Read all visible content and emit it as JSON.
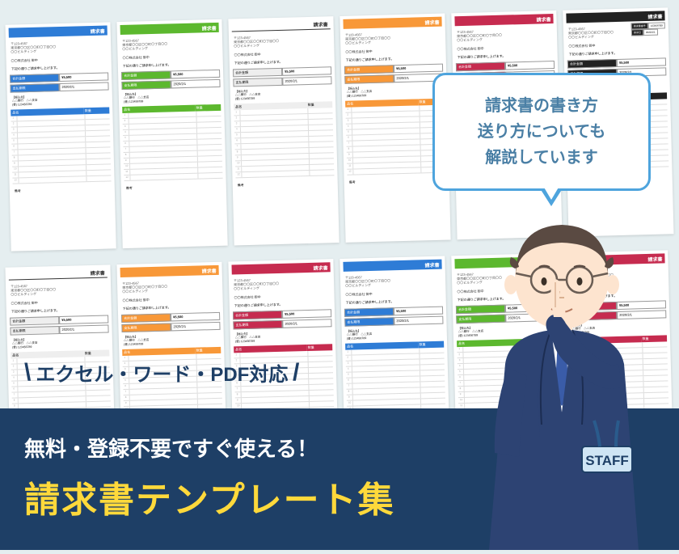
{
  "templates": {
    "title": "請求書",
    "postal": "〒123-4567",
    "address": "東京都〇〇区〇〇町〇丁目〇〇",
    "building": "〇〇ビルディング",
    "company": "〇〇株式会社 御中",
    "ack": "下記の通りご請求申し上げます。",
    "sum_label": "合計金額",
    "sum_value": "¥5,500",
    "due_label": "支払期限",
    "due_value": "2020/2/1",
    "bank_title": "【振込先】",
    "bank_branch": "△△銀行　△△支店",
    "bank_number": "(普) 123456789",
    "col_item": "品名",
    "col_qty": "数量",
    "rows_count": 12,
    "footer_label": "備考",
    "meta_no_label": "請求書番号",
    "meta_no_value": "123456789",
    "meta_date_label": "請求日",
    "meta_date_value": "2020/1/1",
    "variants_top": [
      "blue",
      "green",
      "none",
      "orange",
      "red",
      "black"
    ],
    "variants_bot": [
      "none",
      "orange",
      "red",
      "blue",
      "green",
      "red"
    ]
  },
  "bubble": {
    "line1": "請求書の書き方",
    "line2": "送り方についても",
    "line3": "解説しています"
  },
  "sub_banner": "エクセル・ワード・PDF対応",
  "banner": {
    "line1": "無料・登録不要ですぐ使える！",
    "line2": "請求書テンプレート集"
  },
  "character": {
    "badge_text": "STAFF"
  }
}
